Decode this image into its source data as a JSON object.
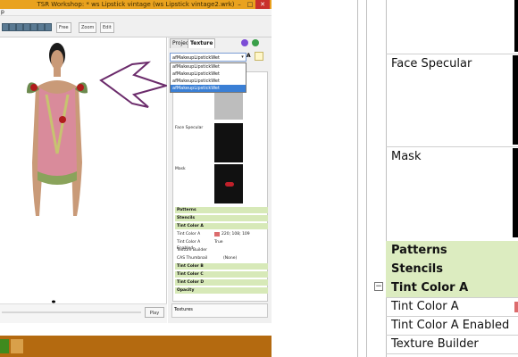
{
  "app": {
    "title": "TSR Workshop: * ws Lipstick vintage (ws Lipstick vintage2.wrk)",
    "menu_first": "p",
    "window_controls": [
      "–",
      "□",
      "✕"
    ]
  },
  "toolbar": {
    "dropdown_free": "Free",
    "dropdown_zoom": "Zoom",
    "edit": "Edit"
  },
  "tabs": [
    "Project",
    "Texture"
  ],
  "texture_dropdown": {
    "value": "afMakeupLipstickWet",
    "options": [
      "afMakeupLipstickWet",
      "afMakeupLipstickWet",
      "afMakeupLipstickWet",
      "afMakeupLipstickWet"
    ],
    "selected_index": 3
  },
  "small_props": {
    "face_specular": "Face Specular",
    "mask": "Mask",
    "patterns": "Patterns",
    "stencils": "Stencils",
    "tint_color_a": "Tint Color A",
    "tint_a_label": "Tint Color A",
    "tint_a_value": "220; 108; 109",
    "tint_a_enabled_label": "Tint Color A Enabled",
    "tint_a_enabled_value": "True",
    "texture_builder": "Texture Builder",
    "cas_thumbnail": "CAS Thumbnail",
    "cas_thumbnail_value": "(None)",
    "tint_color_b": "Tint Color B",
    "tint_color_c": "Tint Color C",
    "tint_color_d": "Tint Color D",
    "opacity": "Opacity"
  },
  "textures_label": "Textures",
  "play_label": "Play",
  "big_panel": {
    "face_specular": "Face Specular",
    "mask": "Mask",
    "patterns": "Patterns",
    "stencils": "Stencils",
    "tint_color_a": "Tint Color A",
    "tint_a_label": "Tint Color A",
    "tint_a_enabled": "Tint Color A Enabled",
    "texture_builder": "Texture Builder",
    "collapse_glyph": "−"
  },
  "colors": {
    "titlebar": "#e9a21f",
    "taskbar": "#b46a10",
    "group_green": "#dcecc0",
    "selection_blue": "#3a7fd5",
    "arrow": "#6b2b6b"
  }
}
